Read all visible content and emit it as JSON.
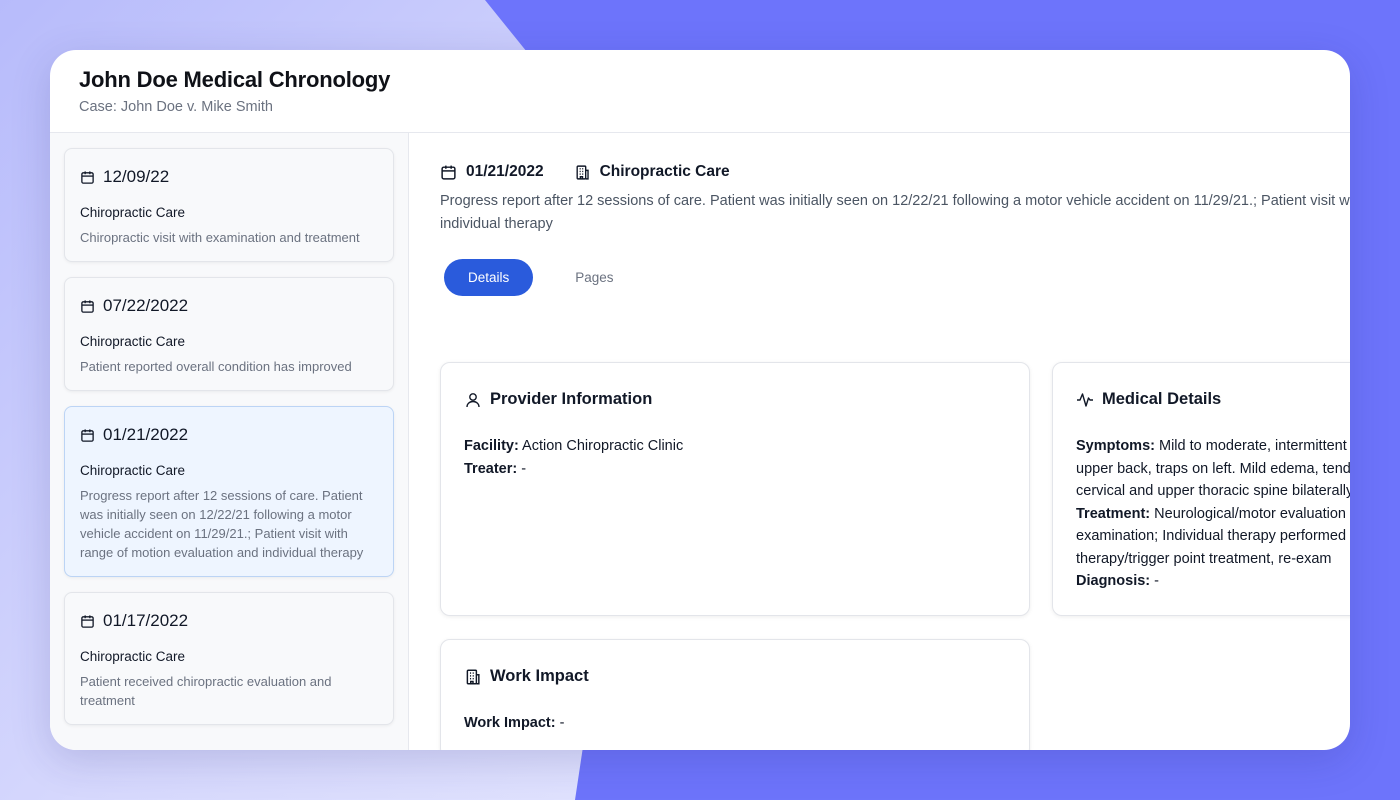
{
  "header": {
    "title": "John Doe Medical Chronology",
    "subtitle": "Case: John Doe v. Mike Smith"
  },
  "sidebar": {
    "cards": [
      {
        "date": "12/09/22",
        "type": "Chiropractic Care",
        "desc": "Chiropractic visit with examination and treatment"
      },
      {
        "date": "07/22/2022",
        "type": "Chiropractic Care",
        "desc": "Patient reported overall condition has improved"
      },
      {
        "date": "01/21/2022",
        "type": "Chiropractic Care",
        "desc": "Progress report after 12 sessions of care. Patient was initially seen on 12/22/21 following a motor vehicle accident on 11/29/21.; Patient visit with range of motion evaluation and individual therapy"
      },
      {
        "date": "01/17/2022",
        "type": "Chiropractic Care",
        "desc": "Patient received chiropractic evaluation and treatment"
      }
    ]
  },
  "main": {
    "date": "01/21/2022",
    "category": "Chiropractic Care",
    "desc_line1": "Progress report after 12 sessions of care. Patient was initially seen on 12/22/21 following a motor vehicle accident on 11/29/21.; Patient visit with range of motion evaluation and",
    "desc_line2": "individual therapy",
    "tabs": [
      {
        "label": "Details",
        "active": true
      },
      {
        "label": "Pages",
        "active": false
      }
    ]
  },
  "provider": {
    "title": "Provider Information",
    "facility_label": "Facility:",
    "facility_value": "Action Chiropractic Clinic",
    "treater_label": "Treater:",
    "treater_value": "-"
  },
  "medical": {
    "title": "Medical Details",
    "symptoms_label": "Symptoms:",
    "symptoms_line1": "Mild to moderate, intermittent",
    "symptoms_line2": "upper back, traps on left. Mild edema, tenderness",
    "symptoms_line3": "cervical and upper thoracic spine bilaterally",
    "treatment_label": "Treatment:",
    "treatment_line1": "Neurological/motor evaluation",
    "treatment_line2": "examination; Individual therapy performed",
    "treatment_line3": "therapy/trigger point treatment, re-exam",
    "diagnosis_label": "Diagnosis:",
    "diagnosis_value": "-"
  },
  "work": {
    "title": "Work Impact",
    "label": "Work Impact:",
    "value": "-"
  },
  "colors": {
    "accent": "#2a5bdc",
    "background": "#6d74fb",
    "active_card": "#eef5ff"
  }
}
